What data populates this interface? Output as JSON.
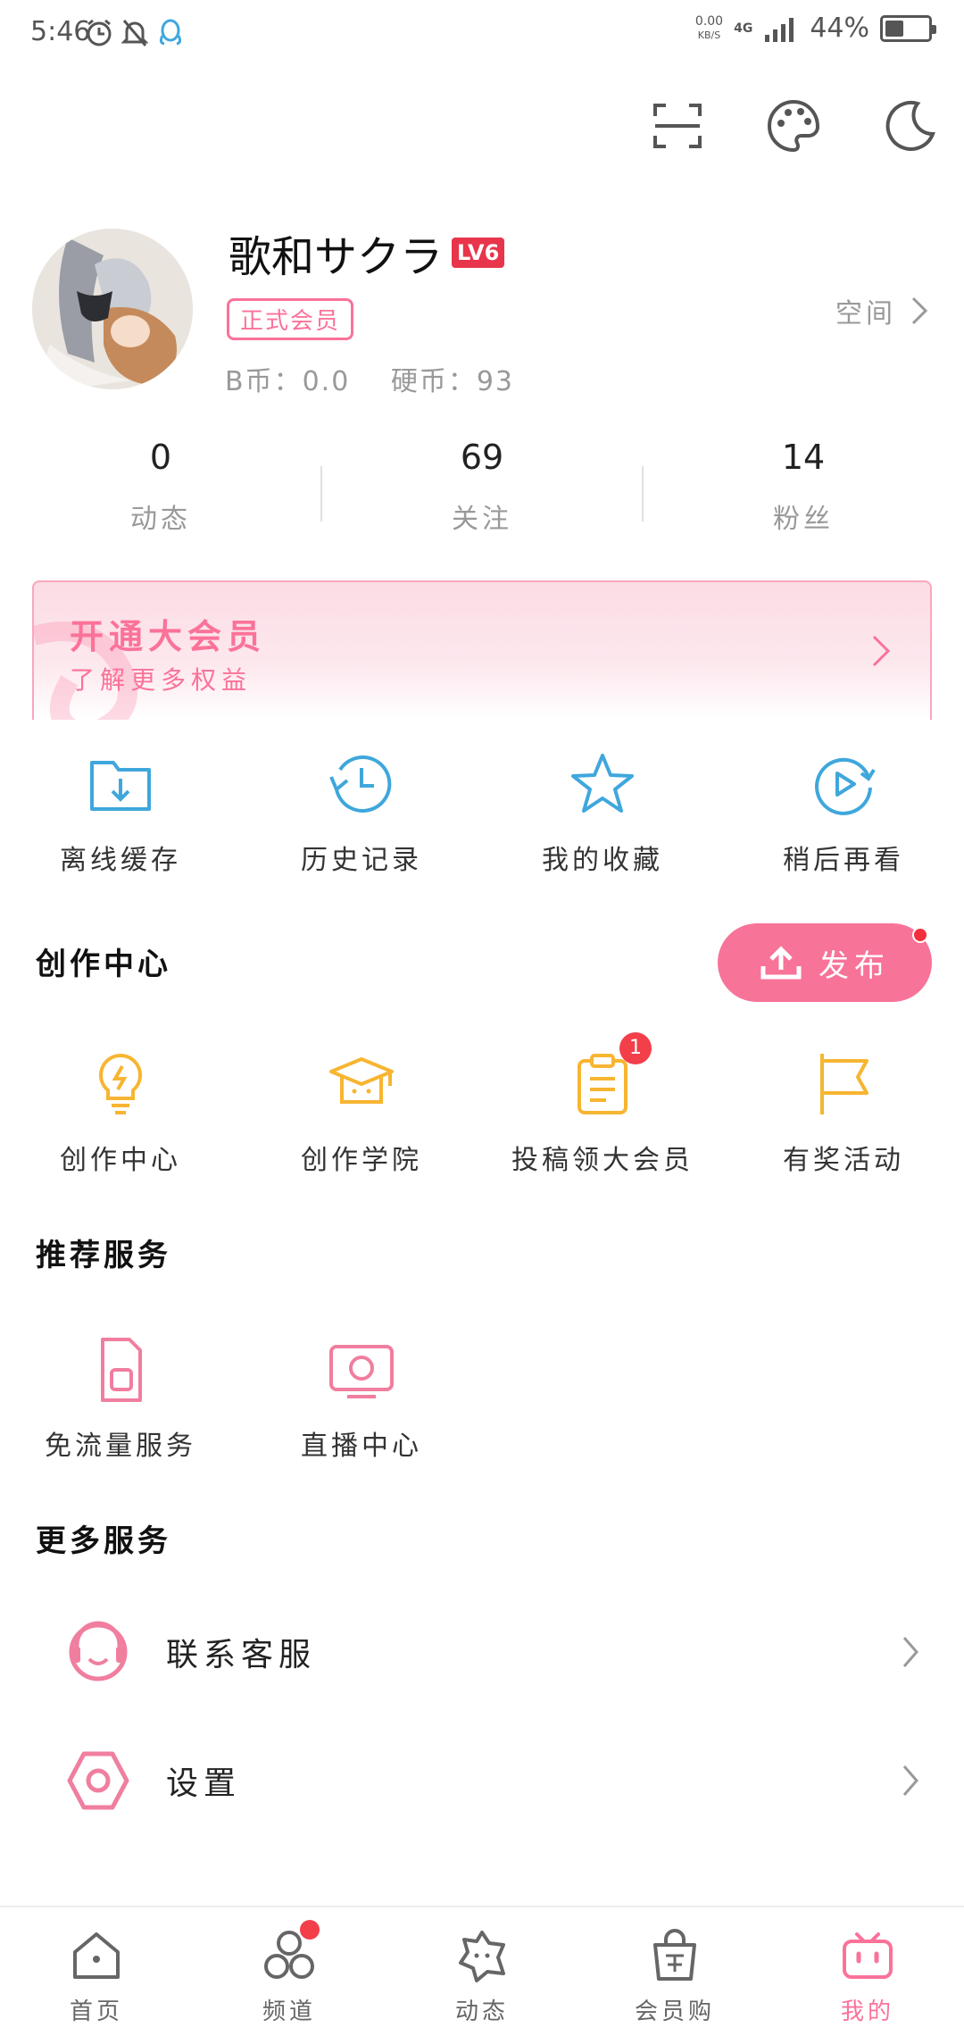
{
  "status_bar": {
    "time": "5:46",
    "speed_value": "0.00",
    "speed_unit": "KB/S",
    "network": "4G",
    "battery_percent": "44%",
    "battery_level": 0.44
  },
  "top_icons": [
    "scan-icon",
    "palette-icon",
    "night-mode-icon"
  ],
  "profile": {
    "username": "歌和サクラ",
    "level_badge": "LV6",
    "member_tag": "正式会员",
    "bcoin": "B币：0.0",
    "coin": "硬币：93",
    "space_label": "空间"
  },
  "stats": [
    {
      "value": "0",
      "label": "动态"
    },
    {
      "value": "69",
      "label": "关注"
    },
    {
      "value": "14",
      "label": "粉丝"
    }
  ],
  "vip_banner": {
    "title": "开通大会员",
    "subtitle": "了解更多权益"
  },
  "quick_actions": [
    {
      "label": "离线缓存",
      "icon": "download-folder-icon"
    },
    {
      "label": "历史记录",
      "icon": "history-clock-icon"
    },
    {
      "label": "我的收藏",
      "icon": "star-icon"
    },
    {
      "label": "稍后再看",
      "icon": "watch-later-icon"
    }
  ],
  "creation": {
    "section_title": "创作中心",
    "publish_label": "发布",
    "items": [
      {
        "label": "创作中心",
        "icon": "lightbulb-icon"
      },
      {
        "label": "创作学院",
        "icon": "graduation-cap-icon"
      },
      {
        "label": "投稿领大会员",
        "icon": "clipboard-icon",
        "badge": "1"
      },
      {
        "label": "有奖活动",
        "icon": "flag-icon"
      }
    ]
  },
  "recommended": {
    "section_title": "推荐服务",
    "items": [
      {
        "label": "免流量服务",
        "icon": "sim-card-icon"
      },
      {
        "label": "直播中心",
        "icon": "live-tv-icon"
      }
    ]
  },
  "more": {
    "section_title": "更多服务",
    "items": [
      {
        "label": "联系客服",
        "icon": "headset-icon"
      },
      {
        "label": "设置",
        "icon": "settings-hexagon-icon"
      }
    ]
  },
  "bottom_nav": [
    {
      "label": "首页",
      "icon": "home-icon"
    },
    {
      "label": "频道",
      "icon": "channel-icon"
    },
    {
      "label": "动态",
      "icon": "dynamic-icon"
    },
    {
      "label": "会员购",
      "icon": "shopping-bag-icon"
    },
    {
      "label": "我的",
      "icon": "tv-mine-icon"
    }
  ],
  "colors": {
    "accent_pink": "#fb7299",
    "quick_blue": "#3fa7dc",
    "creation_yellow": "#f7b531",
    "badge_red": "#f23f4a",
    "level_red": "#e8354b"
  }
}
